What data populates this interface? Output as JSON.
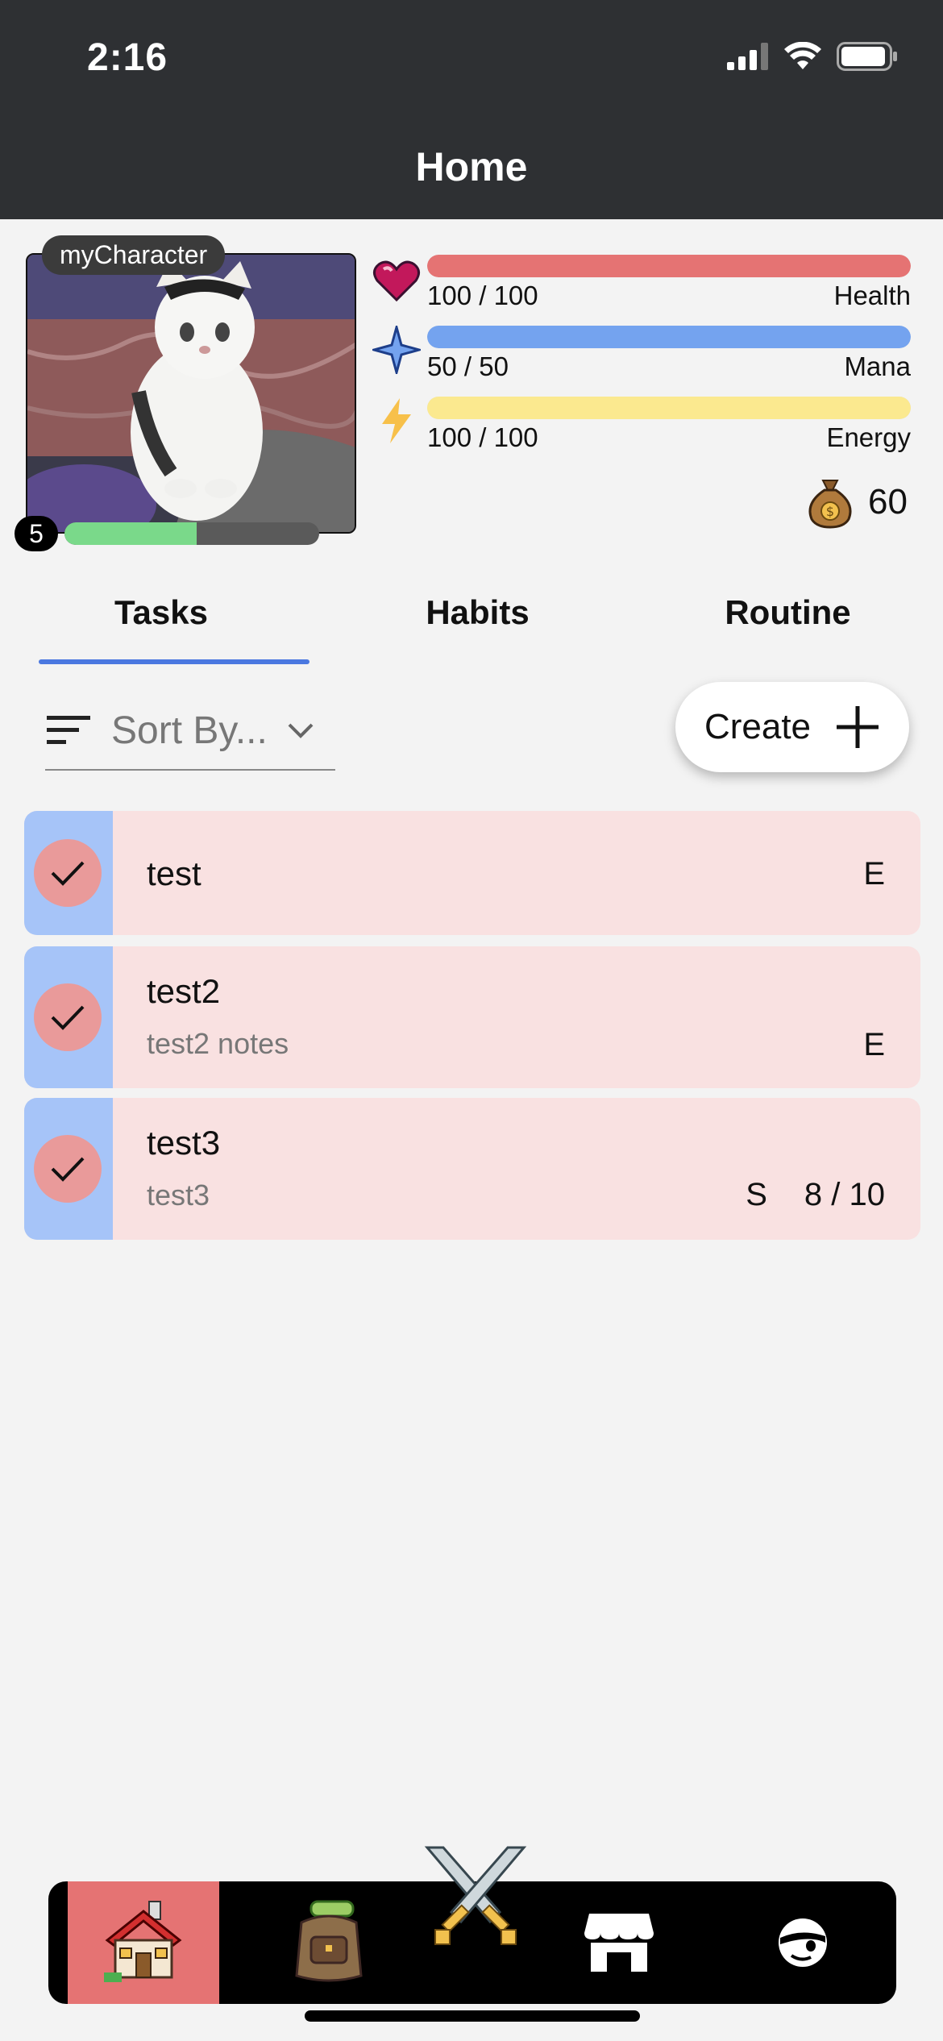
{
  "status_bar": {
    "time": "2:16"
  },
  "header": {
    "title": "Home"
  },
  "character": {
    "name": "myCharacter",
    "level": "5",
    "xp_fraction": 0.52
  },
  "stats": {
    "health": {
      "label": "Health",
      "value": "100 / 100",
      "fraction": 1.0,
      "color": "#e57373"
    },
    "mana": {
      "label": "Mana",
      "value": "50 / 50",
      "fraction": 1.0,
      "color": "#74a3ef"
    },
    "energy": {
      "label": "Energy",
      "value": "100 / 100",
      "fraction": 1.0,
      "color": "#fbe98f"
    }
  },
  "gold": {
    "amount": "60"
  },
  "tabs": [
    {
      "label": "Tasks",
      "active": true
    },
    {
      "label": "Habits",
      "active": false
    },
    {
      "label": "Routine",
      "active": false
    }
  ],
  "sort": {
    "placeholder": "Sort By..."
  },
  "create_button": {
    "label": "Create"
  },
  "tasks": [
    {
      "title": "test",
      "notes": "",
      "difficulty": "E",
      "progress": ""
    },
    {
      "title": "test2",
      "notes": "test2 notes",
      "difficulty": "E",
      "progress": ""
    },
    {
      "title": "test3",
      "notes": "test3",
      "difficulty": "S",
      "progress": "8 / 10"
    }
  ],
  "nav": {
    "items": [
      "home-icon",
      "inventory-icon",
      "battle-icon",
      "shop-icon",
      "profile-icon"
    ],
    "active": "home-icon",
    "active_color": "#e57373"
  }
}
